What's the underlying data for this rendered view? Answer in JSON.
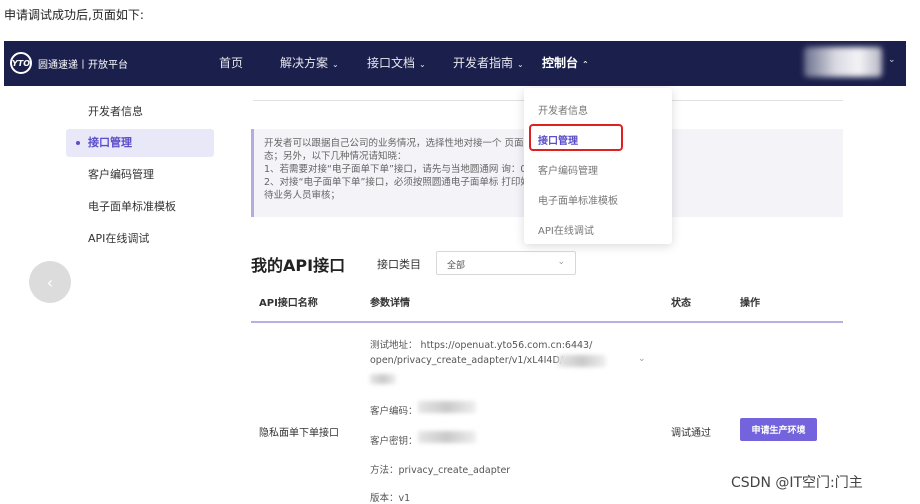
{
  "caption": "申请调试成功后,页面如下:",
  "navbar": {
    "logo_mark": "YTO",
    "logo_text": "圆通速递丨开放平台",
    "items": [
      {
        "label": "首页",
        "caret": ""
      },
      {
        "label": "解决方案",
        "caret": "⌄"
      },
      {
        "label": "接口文档",
        "caret": "⌄"
      },
      {
        "label": "开发者指南",
        "caret": "⌄"
      },
      {
        "label": "控制台",
        "caret": "⌃"
      }
    ],
    "right_caret": "⌄"
  },
  "sidebar": {
    "items": [
      {
        "label": "开发者信息"
      },
      {
        "label": "接口管理"
      },
      {
        "label": "客户编码管理"
      },
      {
        "label": "电子面单标准模板"
      },
      {
        "label": "API在线调试"
      }
    ]
  },
  "notice": {
    "lines": [
      "开发者可以跟据自己公司的业务情况，选择性地对接一个                                                页面查看所有对接接口的任务状",
      "态；另外，以下几种情况请知晓：",
      "1、若需要对接“电子面单下单”接口，请先与当地圆通网                                              询：021-69773588；",
      "2、对接“电子面单下单”接口，必须按照圆通电子面单标                                             打印好的电子面单拍照上传，等",
      "待业务人员审核；"
    ]
  },
  "api": {
    "title": "我的API接口",
    "category_label": "接口类目",
    "category_value": "全部",
    "headers": [
      "API接口名称",
      "参数详情",
      "状态",
      "操作"
    ],
    "row": {
      "name": "隐私面单下单接口",
      "test_url_label": "测试地址：",
      "test_url_line1": "https://openuat.yto56.com.cn:6443/",
      "test_url_line2": "open/privacy_create_adapter/v1/xL4I4D/",
      "customer_code": "客户编码：",
      "customer_secret": "客户密钥：",
      "method": "方法：privacy_create_adapter",
      "version": "版本：v1",
      "status": "调试通过",
      "action": "申请生产环境"
    }
  },
  "dropdown": {
    "items": [
      "开发者信息",
      "接口管理",
      "客户编码管理",
      "电子面单标准模板",
      "API在线调试"
    ],
    "active_index": 1,
    "highlight_color": "#e0201f"
  },
  "watermark": "CSDN @IT空门:门主",
  "colors": {
    "nav_bg": "#1b1f4b",
    "accent": "#7364dd"
  }
}
